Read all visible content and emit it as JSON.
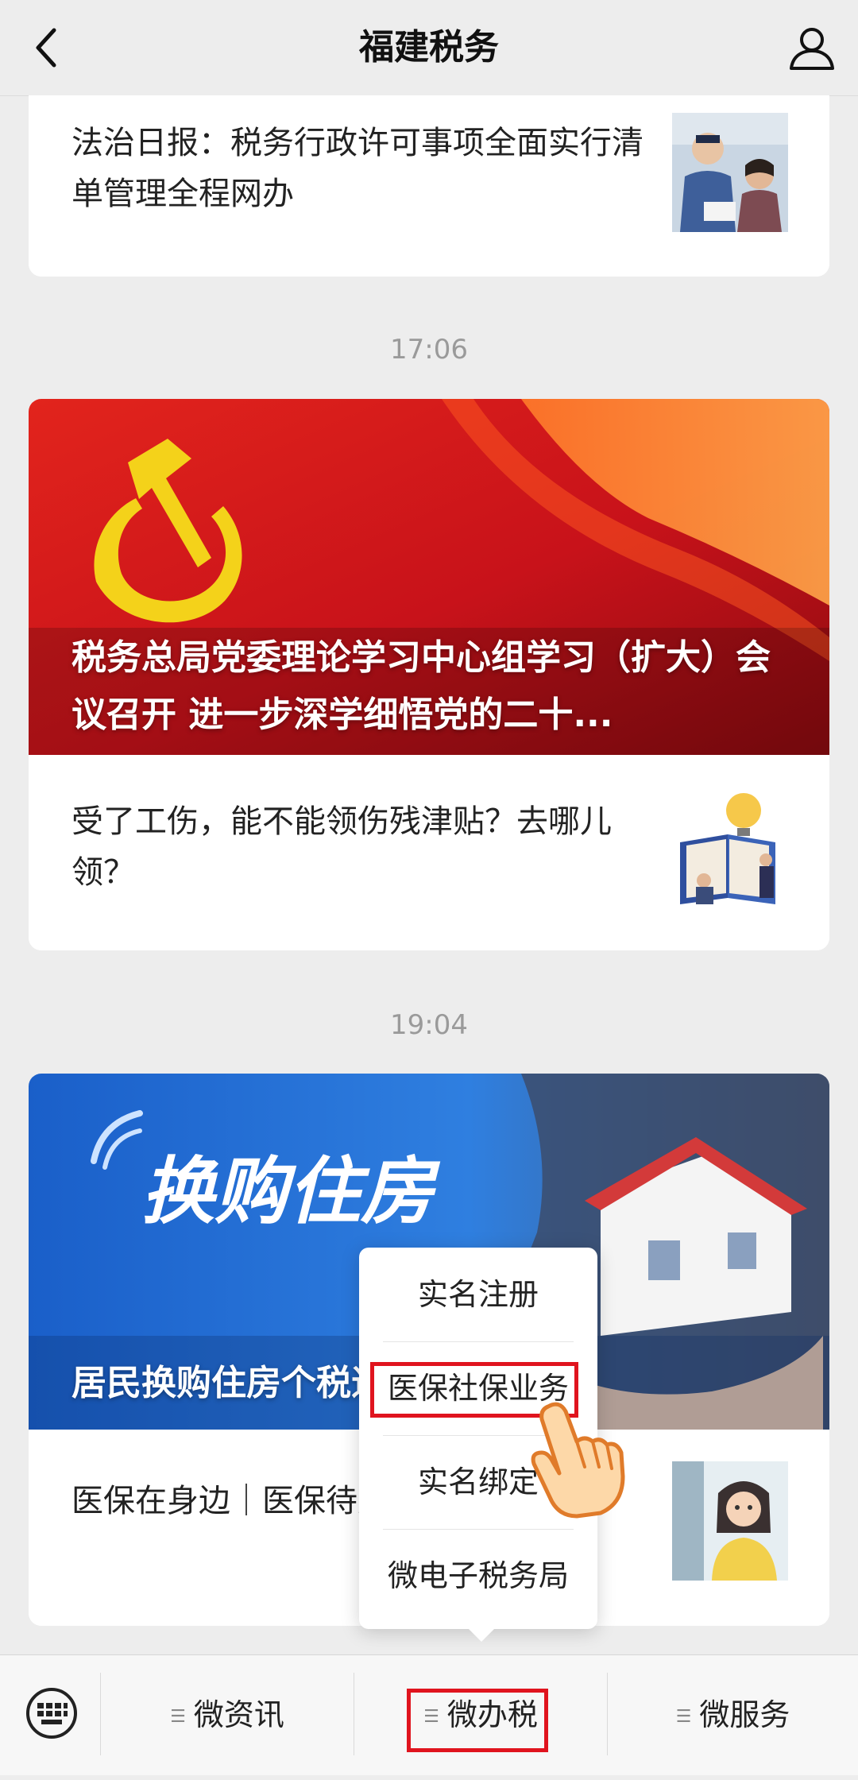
{
  "header": {
    "title": "福建税务"
  },
  "feed": {
    "card1": {
      "item_title": "法治日报：税务行政许可事项全面实行清单管理全程网办"
    },
    "time1": "17:06",
    "card2": {
      "banner_caption": "税务总局党委理论学习中心组学习（扩大）会议召开 进一步深学细悟党的二十...",
      "item_title": "受了工伤，能不能领伤残津贴？去哪儿领？"
    },
    "time2": "19:04",
    "card3": {
      "banner_headline": "换购住房",
      "banner_caption": "居民换购住房个税退税看这里 →",
      "item_title": "医保在身边｜医保待遇该怎么办？"
    }
  },
  "popup_menu": {
    "items": [
      "实名注册",
      "医保社保业务",
      "实名绑定",
      "微电子税务局"
    ],
    "highlighted_index": 1
  },
  "bottom_bar": {
    "tabs": [
      "微资讯",
      "微办税",
      "微服务"
    ],
    "active_index": 1
  },
  "colors": {
    "highlight_border": "#e0141e",
    "party_red": "#d0161a",
    "emblem_yellow": "#f4d21a",
    "housing_blue": "#1a5fc9"
  }
}
